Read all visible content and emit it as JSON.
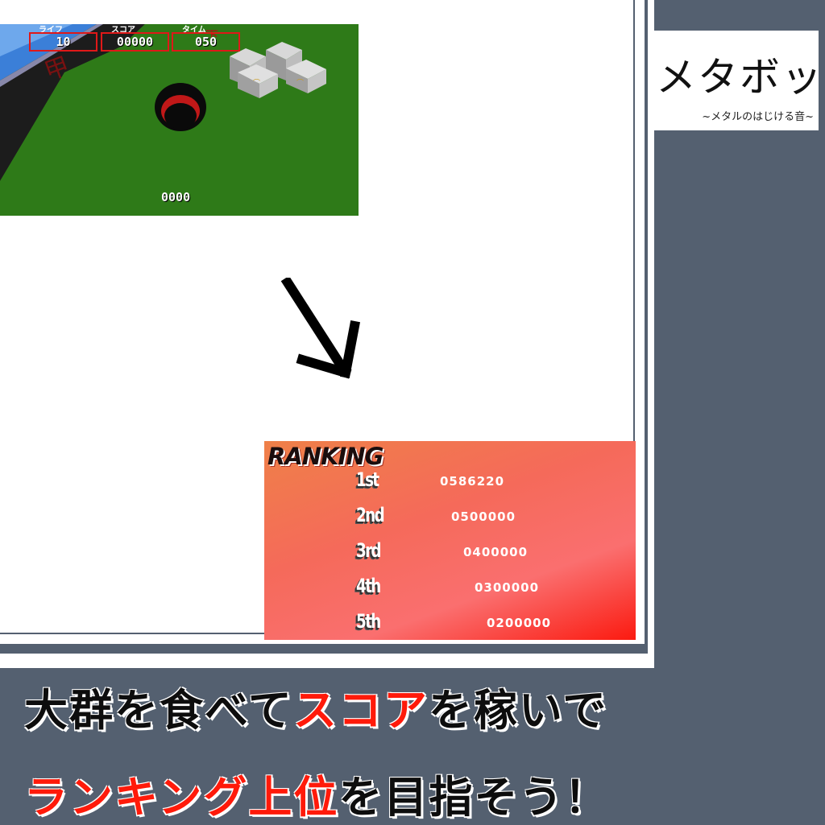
{
  "game": {
    "hud": {
      "life_label": "ライフ",
      "life_value": "10",
      "score_label": "スコア",
      "score_value": "00000",
      "time_label": "タイム",
      "time_value": "050"
    },
    "counter": "0000"
  },
  "logo": {
    "title": "メタボット",
    "subtitle": "~メタルのはじける音~"
  },
  "ranking": {
    "title": "RANKING",
    "entries": [
      {
        "place": "1st",
        "score": "0586220"
      },
      {
        "place": "2nd",
        "score": "0500000"
      },
      {
        "place": "3rd",
        "score": "0400000"
      },
      {
        "place": "4th",
        "score": "0300000"
      },
      {
        "place": "5th",
        "score": "0200000"
      }
    ]
  },
  "caption": {
    "line1_a": "大群を食べて",
    "line1_b": "スコア",
    "line1_c": "を稼いで",
    "line2_a": "ランキング上位",
    "line2_b": "を目指そう！"
  },
  "colors": {
    "background": "#546070",
    "accent_red": "#ff1a0a",
    "grass": "#2f7a1a"
  }
}
